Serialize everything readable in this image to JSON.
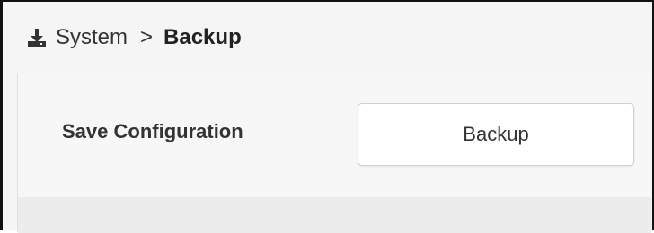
{
  "breadcrumb": {
    "icon": "download-icon",
    "parent": "System",
    "separator": ">",
    "current": "Backup"
  },
  "save_configuration": {
    "label": "Save Configuration",
    "button_label": "Backup"
  }
}
